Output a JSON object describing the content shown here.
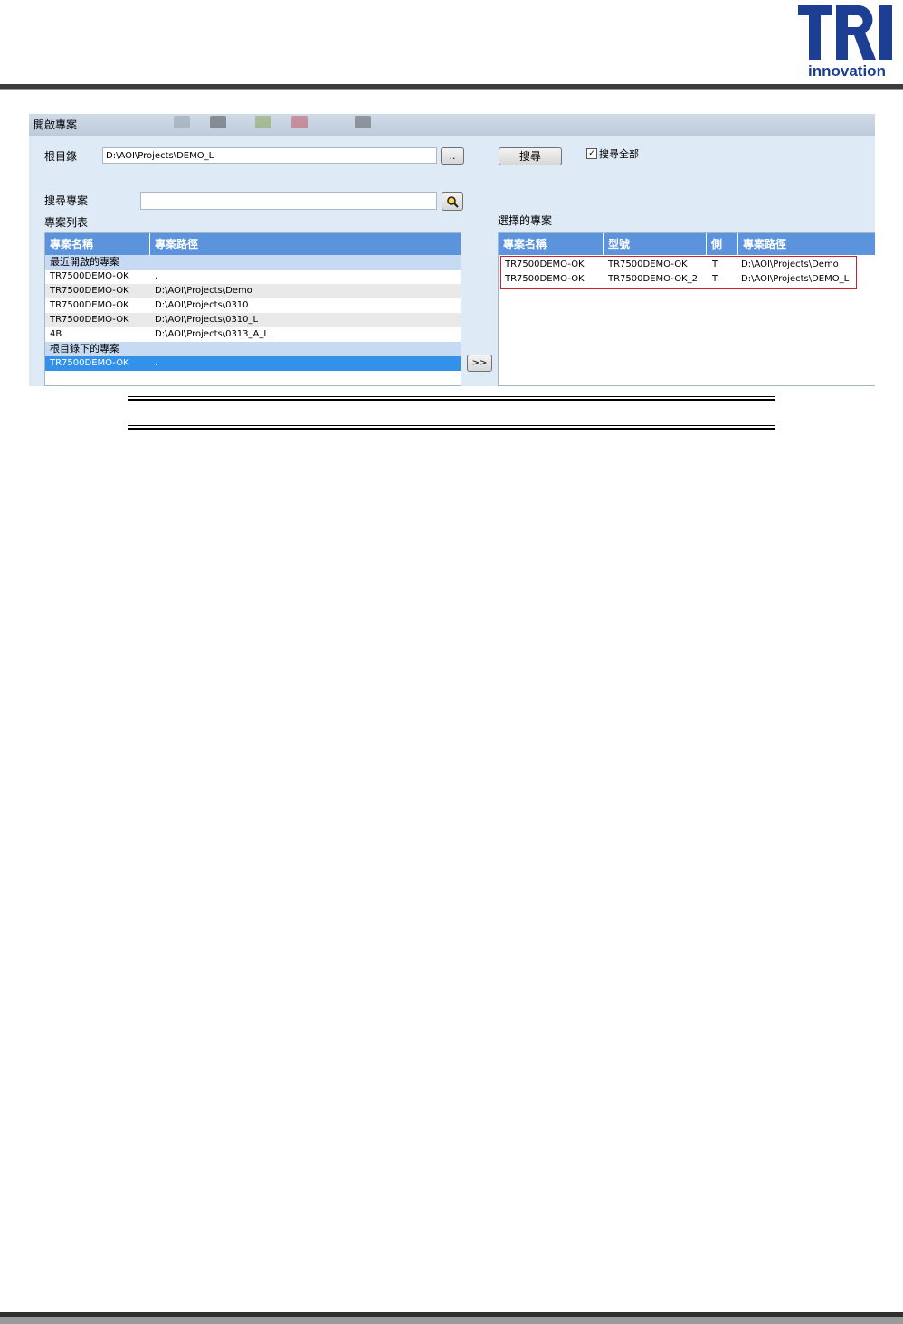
{
  "logo": {
    "word": "TRI",
    "sub": "innovation",
    "color": "#1c3f94"
  },
  "window": {
    "title": "開啟專案",
    "root_label": "根目錄",
    "root_value": "D:\\AOI\\Projects\\DEMO_L",
    "browse_label": "..",
    "search_button": "搜尋",
    "search_all_label": "搜尋全部",
    "search_all_checked": true,
    "search_project_label": "搜尋專案",
    "search_project_value": "",
    "project_list_label": "專案列表",
    "selected_label": "選擇的專案",
    "move_button": ">>"
  },
  "left_grid": {
    "columns": [
      "專案名稱",
      "專案路徑"
    ],
    "rows": [
      {
        "type": "group",
        "name": "最近開啟的專案",
        "path": ""
      },
      {
        "type": "data",
        "name": "TR7500DEMO-OK",
        "path": "."
      },
      {
        "type": "data",
        "name": "TR7500DEMO-OK",
        "path": "D:\\AOI\\Projects\\Demo"
      },
      {
        "type": "data",
        "name": "TR7500DEMO-OK",
        "path": "D:\\AOI\\Projects\\0310"
      },
      {
        "type": "data",
        "name": "TR7500DEMO-OK",
        "path": "D:\\AOI\\Projects\\0310_L"
      },
      {
        "type": "data",
        "name": "4B",
        "path": "D:\\AOI\\Projects\\0313_A_L"
      },
      {
        "type": "group",
        "name": "根目錄下的專案",
        "path": ""
      },
      {
        "type": "selected",
        "name": "TR7500DEMO-OK",
        "path": "."
      }
    ]
  },
  "right_grid": {
    "columns": [
      "專案名稱",
      "型號",
      "側",
      "專案路徑"
    ],
    "rows": [
      {
        "name": "TR7500DEMO-OK",
        "model": "TR7500DEMO-OK",
        "side": "T",
        "path": "D:\\AOI\\Projects\\Demo"
      },
      {
        "name": "TR7500DEMO-OK",
        "model": "TR7500DEMO-OK_2",
        "side": "T",
        "path": "D:\\AOI\\Projects\\DEMO_L"
      }
    ]
  }
}
